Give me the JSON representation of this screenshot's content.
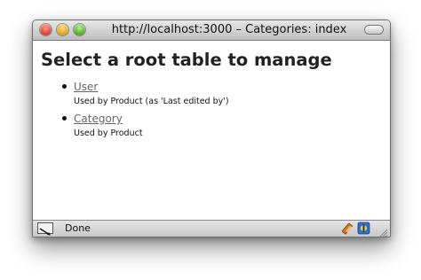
{
  "window": {
    "title": "http://localhost:3000 – Categories: index"
  },
  "page": {
    "heading": "Select a root table to manage",
    "items": [
      {
        "link": "User",
        "description": "Used by Product (as 'Last edited by')"
      },
      {
        "link": "Category",
        "description": "Used by Product"
      }
    ]
  },
  "statusbar": {
    "text": "Done",
    "left_icon": "network-activity-icon",
    "tray_icons": [
      "bookmark-tool-icon",
      "extension-icon"
    ]
  },
  "colors": {
    "link": "#666666",
    "heading": "#222222"
  }
}
